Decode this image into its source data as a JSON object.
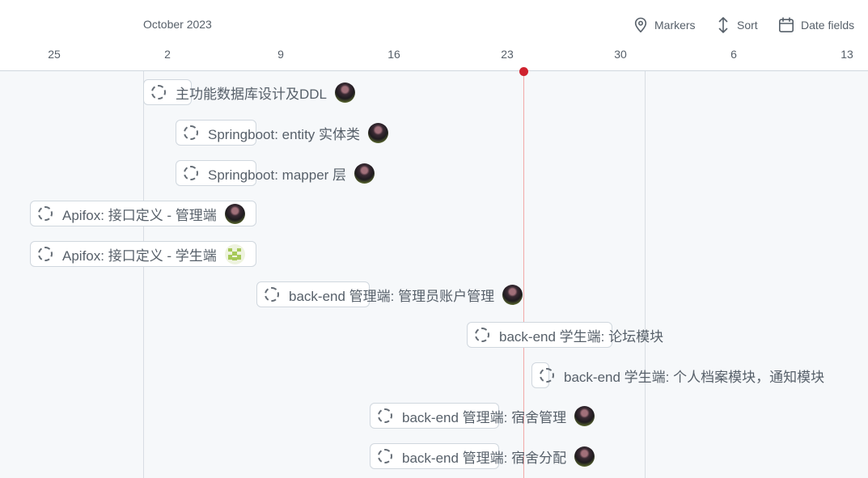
{
  "timeline": {
    "month_label": "October 2023",
    "ticks": [
      "25",
      "2",
      "9",
      "16",
      "23",
      "30",
      "6",
      "13"
    ]
  },
  "toolbar": {
    "markers": "Markers",
    "sort": "Sort",
    "date_fields": "Date fields"
  },
  "items": [
    {
      "title": "主功能数据库设计及DDL",
      "avatar": "user-avatar"
    },
    {
      "title": "Springboot: entity 实体类",
      "avatar": "user-avatar"
    },
    {
      "title": "Springboot: mapper 层",
      "avatar": "user-avatar"
    },
    {
      "title": "Apifox: 接口定义 - 管理端",
      "avatar": "user-avatar"
    },
    {
      "title": "Apifox: 接口定义 - 学生端",
      "avatar": "identicon-avatar"
    },
    {
      "title": "back-end 管理端: 管理员账户管理",
      "avatar": "user-avatar"
    },
    {
      "title": "back-end 学生端: 论坛模块",
      "avatar": ""
    },
    {
      "title": "back-end 学生端: 个人档案模块，通知模块",
      "avatar": ""
    },
    {
      "title": "back-end 管理端: 宿舍管理",
      "avatar": "user-avatar"
    },
    {
      "title": "back-end 管理端: 宿舍分配",
      "avatar": "user-avatar"
    }
  ]
}
